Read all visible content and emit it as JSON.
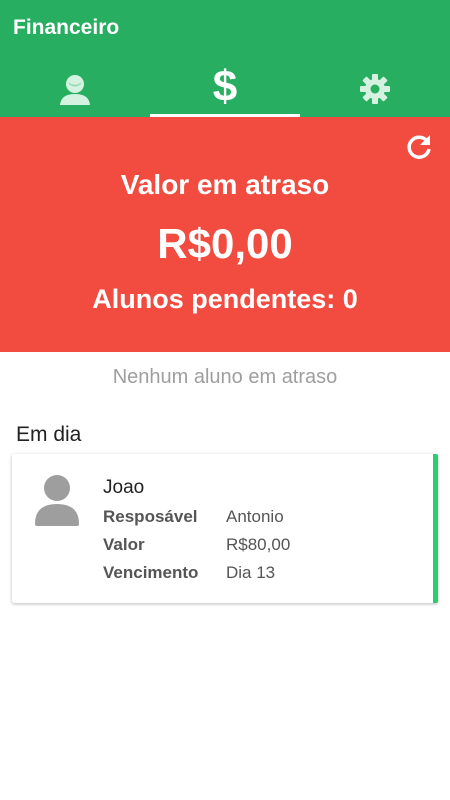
{
  "appbar": {
    "title": "Financeiro",
    "color": "#27AE60",
    "tabs": [
      {
        "id": "students",
        "icon": "person-icon",
        "active": false
      },
      {
        "id": "finance",
        "icon": "dollar-icon",
        "glyph": "$",
        "active": true
      },
      {
        "id": "settings",
        "icon": "gear-icon",
        "active": false
      }
    ]
  },
  "overdue": {
    "color": "#F24B3F",
    "label": "Valor em atraso",
    "amount": "R$0,00",
    "pending": "Alunos pendentes: 0",
    "refresh_icon": "refresh-icon"
  },
  "empty_message": "Nenhum aluno em atraso",
  "on_time": {
    "title": "Em dia",
    "accent": "#2ECC71",
    "students": [
      {
        "name": "Joao",
        "avatar_icon": "avatar-icon",
        "fields": [
          {
            "label": "Resposável",
            "value": "Antonio"
          },
          {
            "label": "Valor",
            "value": "R$80,00"
          },
          {
            "label": "Vencimento",
            "value": "Dia 13"
          }
        ]
      }
    ]
  }
}
